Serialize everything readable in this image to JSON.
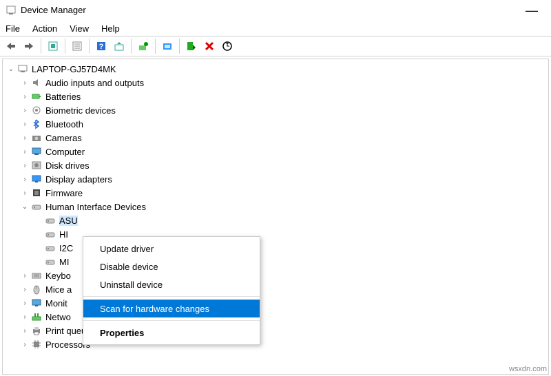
{
  "window": {
    "title": "Device Manager"
  },
  "menu": {
    "file": "File",
    "action": "Action",
    "view": "View",
    "help": "Help"
  },
  "tree": {
    "root": "LAPTOP-GJ57D4MK",
    "items": [
      {
        "label": "Audio inputs and outputs",
        "icon": "audio"
      },
      {
        "label": "Batteries",
        "icon": "battery"
      },
      {
        "label": "Biometric devices",
        "icon": "biometric"
      },
      {
        "label": "Bluetooth",
        "icon": "bluetooth"
      },
      {
        "label": "Cameras",
        "icon": "camera"
      },
      {
        "label": "Computer",
        "icon": "computer"
      },
      {
        "label": "Disk drives",
        "icon": "disk"
      },
      {
        "label": "Display adapters",
        "icon": "display"
      },
      {
        "label": "Firmware",
        "icon": "firmware"
      },
      {
        "label": "Human Interface Devices",
        "icon": "hid",
        "expanded": true
      }
    ],
    "hid_children": [
      {
        "label": "ASU",
        "selected": true
      },
      {
        "label": "HI"
      },
      {
        "label": "I2C"
      },
      {
        "label": "MI"
      }
    ],
    "items_after": [
      {
        "label": "Keybo",
        "icon": "keyboard"
      },
      {
        "label": "Mice a",
        "icon": "mouse"
      },
      {
        "label": "Monit",
        "icon": "monitor"
      },
      {
        "label": "Netwo",
        "icon": "network"
      },
      {
        "label": "Print queues",
        "icon": "print"
      },
      {
        "label": "Processors",
        "icon": "cpu"
      }
    ]
  },
  "context_menu": {
    "update": "Update driver",
    "disable": "Disable device",
    "uninstall": "Uninstall device",
    "scan": "Scan for hardware changes",
    "properties": "Properties"
  },
  "watermark": "wsxdn.com"
}
